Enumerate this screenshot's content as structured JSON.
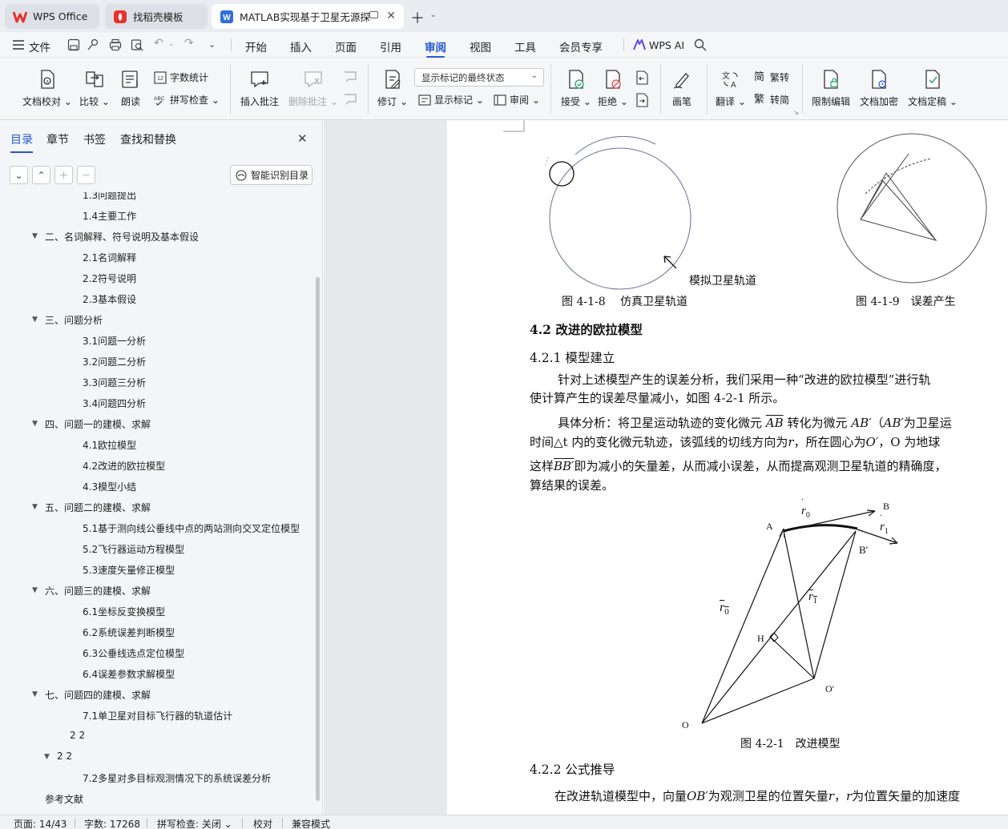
{
  "tabs": [
    {
      "label": "WPS Office"
    },
    {
      "label": "找稻壳模板"
    },
    {
      "label": "MATLAB实现基于卫星无源探"
    }
  ],
  "menu": {
    "file": "文件",
    "items": [
      "开始",
      "插入",
      "页面",
      "引用",
      "审阅",
      "视图",
      "工具",
      "会员专享"
    ],
    "active": "审阅",
    "ai": "WPS AI"
  },
  "ribbon": {
    "doc_check": "文档校对",
    "compare": "比较",
    "read_aloud": "朗读",
    "word_count": "字数统计",
    "spell_check": "拼写检查",
    "insert_comment": "插入批注",
    "delete_comment": "删除批注",
    "track": "修订",
    "markup_state": "显示标记的最终状态",
    "show_markup": "显示标记",
    "review": "审阅",
    "accept": "接受",
    "reject": "拒绝",
    "ink": "画笔",
    "translate": "翻译",
    "to_trad": "繁转",
    "to_simp": "转简",
    "restrict_edit": "限制编辑",
    "encrypt": "文档加密",
    "finalize": "文档定稿"
  },
  "nav": {
    "tabs": [
      "目录",
      "章节",
      "书签",
      "查找和替换"
    ],
    "smart_toc": "智能识别目录",
    "toc": [
      {
        "label": "1.3问题提出",
        "level": 2
      },
      {
        "label": "1.4主要工作",
        "level": 2
      },
      {
        "label": "二、名词解释、符号说明及基本假设",
        "level": 1
      },
      {
        "label": "2.1名词解释",
        "level": 2
      },
      {
        "label": "2.2符号说明",
        "level": 2
      },
      {
        "label": "2.3基本假设",
        "level": 2
      },
      {
        "label": "三、问题分析",
        "level": 1
      },
      {
        "label": "3.1问题一分析",
        "level": 2
      },
      {
        "label": "3.2问题二分析",
        "level": 2
      },
      {
        "label": "3.3问题三分析",
        "level": 2
      },
      {
        "label": "3.4问题四分析",
        "level": 2
      },
      {
        "label": "四、问题一的建模、求解",
        "level": 1
      },
      {
        "label": "4.1欧拉模型",
        "level": 2
      },
      {
        "label": "4.2改进的欧拉模型",
        "level": 2
      },
      {
        "label": "4.3模型小结",
        "level": 2
      },
      {
        "label": "五、问题二的建模、求解",
        "level": 1
      },
      {
        "label": "5.1基于测向线公垂线中点的两站测向交叉定位模型",
        "level": 2
      },
      {
        "label": "5.2飞行器运动方程模型",
        "level": 2
      },
      {
        "label": "5.3速度矢量修正模型",
        "level": 2
      },
      {
        "label": "六、问题三的建模、求解",
        "level": 1
      },
      {
        "label": "6.1坐标反变换模型",
        "level": 2
      },
      {
        "label": "6.2系统误差判断模型",
        "level": 2
      },
      {
        "label": "6.3公垂线选点定位模型",
        "level": 2
      },
      {
        "label": "6.4误差参数求解模型",
        "level": 2
      },
      {
        "label": "七、问题四的建模、求解",
        "level": 1
      },
      {
        "label": "7.1单卫星对目标飞行器的轨道估计",
        "level": 2
      },
      {
        "label": "2 2",
        "level": 2
      },
      {
        "label": "2 2",
        "level": 1
      },
      {
        "label": "7.2多星对多目标观测情况下的系统误差分析",
        "level": 2
      },
      {
        "label": "参考文献",
        "level": 0
      }
    ]
  },
  "document": {
    "fig_418_caption": "图 4-1-8　 仿真卫星轨道",
    "fig_418_annot": "模拟卫星轨道",
    "fig_419_caption": "图 4-1-9　误差产生",
    "h_42": "4.2  改进的欧拉模型",
    "h_421": "4.2.1  模型建立",
    "p1_l1": "针对上述模型产生的误差分析，我们采用一种“改进的欧拉模型”进行轨",
    "p1_l2": "使计算产生的误差尽量减小，如图  4-2-1 所示。",
    "p2_l1a": "具体分析：将卫星运动轨迹的变化微元",
    "p2_ab": "AB",
    "p2_l1b": "转化为微元",
    "p2_ab2": "AB′",
    "p2_l1c": "（",
    "p2_ab3": "AB′",
    "p2_l1d": "为卫星运",
    "p2_l2a": "时间△t 内的变化微元轨迹，该弧线的切线方向为",
    "p2_r1": "r",
    "p2_l2b": "，所在圆心为",
    "p2_o": "O′",
    "p2_l2c": "，O 为地球",
    "p2_l3a": "这样",
    "p2_bb": "BB′",
    "p2_l3b": "即为减小的矢量差，从而减小误差，从而提高观测卫星轨道的精确度，",
    "p2_l4": "算结果的误差。",
    "fig_421_labels": {
      "A": "A",
      "B": "B",
      "B_prime": "B′",
      "H": "H",
      "O": "O",
      "O_prime": "O′",
      "r0": "r",
      "r0_sub": "0",
      "r1": "r",
      "r1_sub": "1"
    },
    "fig_421_caption": "图 4-2-1　改进模型",
    "h_422": "4.2.2  公式推导",
    "p3_l1a": "在改进轨道模型中，向量",
    "p3_ob": "OB′",
    "p3_l1b": "为观测卫星的位置矢量",
    "p3_r": "r",
    "p3_l1c": "，",
    "p3_r2": "r",
    "p3_l1d": "为位置矢量的加速度"
  },
  "status": {
    "page": "页面: 14/43",
    "words": "字数: 17268",
    "spell": "拼写检查: 关闭",
    "proof": "校对",
    "compat": "兼容模式"
  },
  "colors": {
    "accent": "#2458d6",
    "wps_red": "#e8322d"
  }
}
